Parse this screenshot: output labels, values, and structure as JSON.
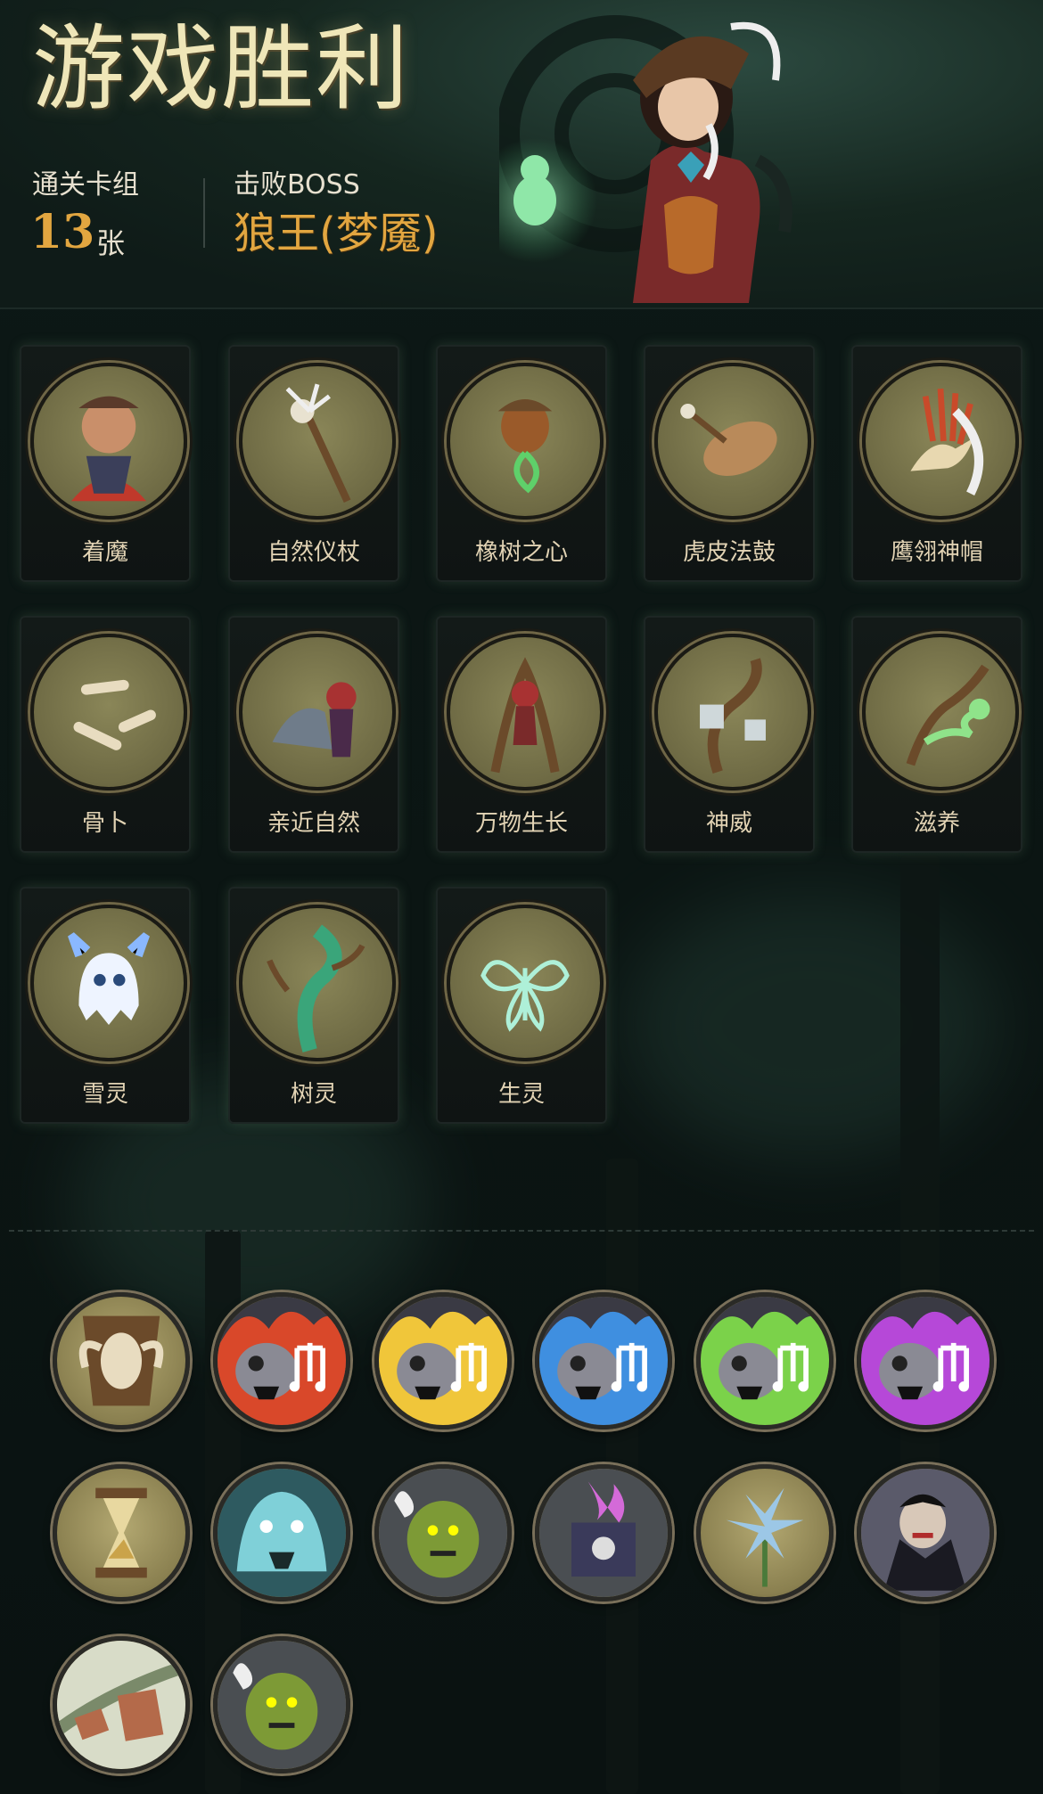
{
  "header": {
    "title": "游戏胜利",
    "deck_label": "通关卡组",
    "deck_count": "13",
    "deck_unit": "张",
    "boss_label": "击败BOSS",
    "boss_name": "狼王(梦魇)"
  },
  "cards": [
    {
      "label": "着魔",
      "icon": "possessed-boy-icon"
    },
    {
      "label": "自然仪杖",
      "icon": "nature-staff-icon"
    },
    {
      "label": "橡树之心",
      "icon": "acorn-heart-icon"
    },
    {
      "label": "虎皮法鼓",
      "icon": "tiger-drum-icon"
    },
    {
      "label": "鹰翎神帽",
      "icon": "eagle-headdress-icon"
    },
    {
      "label": "骨卜",
      "icon": "bones-icon"
    },
    {
      "label": "亲近自然",
      "icon": "wolf-girl-icon"
    },
    {
      "label": "万物生长",
      "icon": "growth-girl-icon"
    },
    {
      "label": "神威",
      "icon": "divine-vine-icon"
    },
    {
      "label": "滋养",
      "icon": "nourish-icon"
    },
    {
      "label": "雪灵",
      "icon": "snow-spirit-icon"
    },
    {
      "label": "树灵",
      "icon": "tree-spirit-icon"
    },
    {
      "label": "生灵",
      "icon": "butterfly-spirit-icon"
    }
  ],
  "relics": [
    {
      "icon": "ram-skull-shield-icon",
      "color": "#c9b887"
    },
    {
      "icon": "red-flame-skull-music-icon",
      "color": "#d9482a"
    },
    {
      "icon": "yellow-flame-skull-music-icon",
      "color": "#f0c63a"
    },
    {
      "icon": "blue-flame-skull-music-icon",
      "color": "#3f8fe0"
    },
    {
      "icon": "green-flame-skull-music-icon",
      "color": "#7bd24a"
    },
    {
      "icon": "purple-flame-skull-music-icon",
      "color": "#b648d8"
    },
    {
      "icon": "hourglass-icon",
      "color": "#caa34a"
    },
    {
      "icon": "ghost-tiger-icon",
      "color": "#7fd0d8"
    },
    {
      "icon": "green-ogre-ghost-icon",
      "color": "#7d9a36"
    },
    {
      "icon": "skull-book-pink-flame-icon",
      "color": "#d46ad8"
    },
    {
      "icon": "blue-flower-icon",
      "color": "#9cc7e6"
    },
    {
      "icon": "vampire-icon",
      "color": "#b02c2c"
    },
    {
      "icon": "flying-scroll-icon",
      "color": "#b46a4a"
    },
    {
      "icon": "green-ogre-ghost-icon",
      "color": "#7d9a36"
    }
  ]
}
